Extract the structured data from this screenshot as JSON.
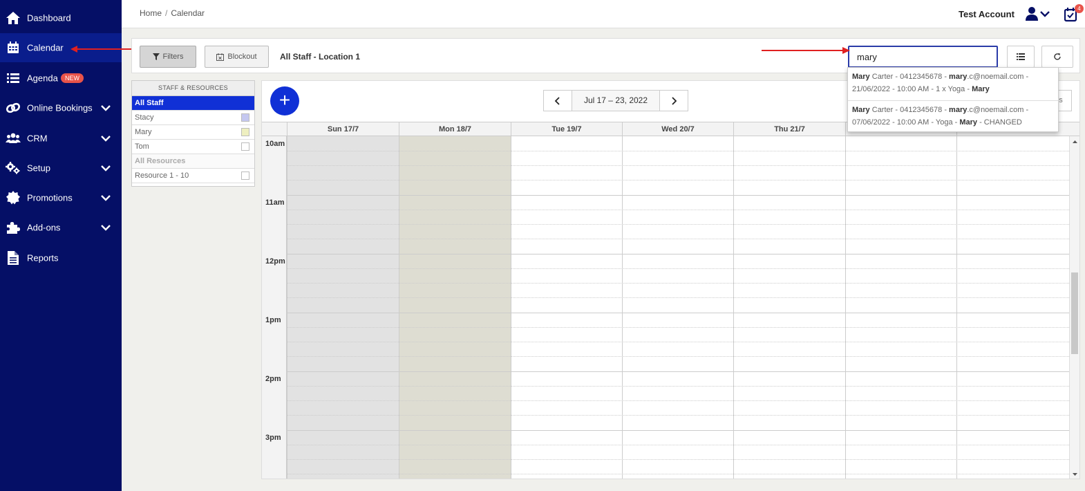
{
  "sidebar": {
    "items": [
      {
        "label": "Dashboard",
        "icon": "home-icon"
      },
      {
        "label": "Calendar",
        "icon": "calendar-icon",
        "active": true
      },
      {
        "label": "Agenda",
        "icon": "list-icon",
        "badge": "NEW"
      },
      {
        "label": "Online Bookings",
        "icon": "link-icon",
        "expandable": true
      },
      {
        "label": "CRM",
        "icon": "users-icon",
        "expandable": true
      },
      {
        "label": "Setup",
        "icon": "gears-icon",
        "expandable": true
      },
      {
        "label": "Promotions",
        "icon": "badge-icon",
        "expandable": true
      },
      {
        "label": "Add-ons",
        "icon": "puzzle-icon",
        "expandable": true
      },
      {
        "label": "Reports",
        "icon": "document-icon"
      }
    ]
  },
  "header": {
    "breadcrumb": [
      "Home",
      "Calendar"
    ],
    "breadcrumb_sep": "/",
    "account_name": "Test Account",
    "task_count": "4"
  },
  "toolbar": {
    "filters_label": "Filters",
    "blockout_label": "Blockout",
    "view_label": "All Staff - Location 1",
    "search_value": "mary"
  },
  "search_results": [
    {
      "name": "Mary",
      "rest_name": " Carter - 0412345678 - ",
      "email_bold": "mary",
      "email_rest": ".c@noemail.com -",
      "line2": "21/06/2022 - 10:00 AM - 1 x Yoga - ",
      "staff": "Mary",
      "suffix": ""
    },
    {
      "name": "Mary",
      "rest_name": " Carter - 0412345678 - ",
      "email_bold": "mary",
      "email_rest": ".c@noemail.com -",
      "line2": "07/06/2022 - 10:00 AM - Yoga - ",
      "staff": "Mary",
      "suffix": " - CHANGED"
    }
  ],
  "staff_panel": {
    "header": "STAFF & RESOURCES",
    "rows": [
      {
        "label": "All Staff",
        "active": true
      },
      {
        "label": "Stacy",
        "color": "#c5c8f0"
      },
      {
        "label": "Mary",
        "color": "#eeefc0"
      },
      {
        "label": "Tom",
        "color": "#ffffff"
      },
      {
        "label": "All Resources",
        "group": true
      },
      {
        "label": "Resource 1 - 10",
        "color": "#ffffff"
      }
    ]
  },
  "calendar": {
    "add_label": "+",
    "date_range": "Jul 17 – 23, 2022",
    "right_button_stub": "s",
    "days": [
      "Sun 17/7",
      "Mon 18/7",
      "Tue 19/7",
      "Wed 20/7",
      "Thu 21/7",
      "",
      ""
    ],
    "times": [
      "10am",
      "11am",
      "12pm",
      "1pm",
      "2pm",
      "3pm"
    ],
    "colors": {
      "sunday_bg": "#e2e2e2",
      "monday_bg": "#deddd2",
      "accent": "#1030d6",
      "sidebar": "#050f66"
    }
  }
}
